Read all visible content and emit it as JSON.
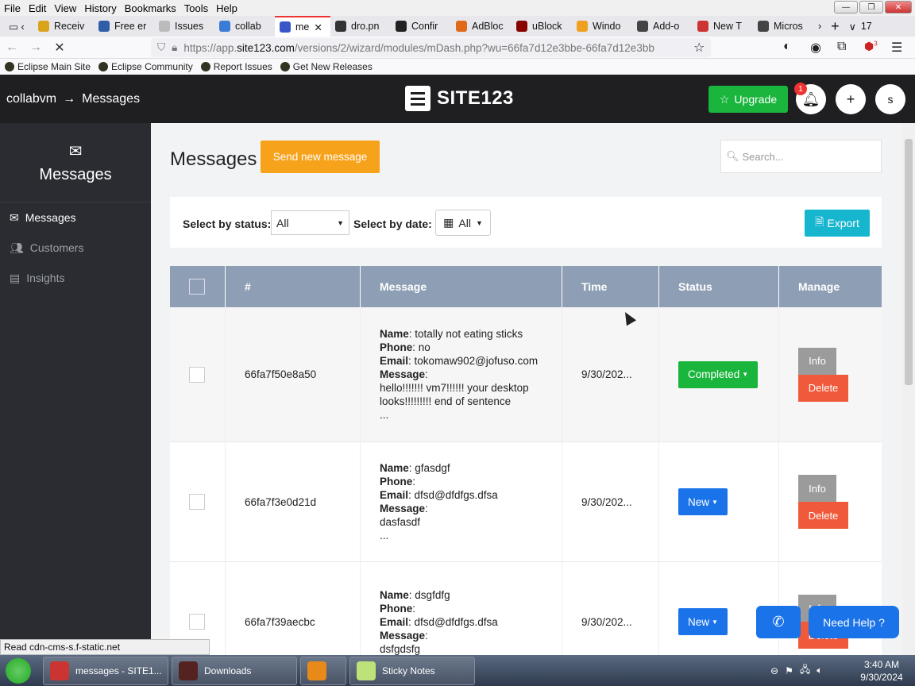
{
  "browser": {
    "menu": [
      "File",
      "Edit",
      "View",
      "History",
      "Bookmarks",
      "Tools",
      "Help"
    ],
    "tabs": [
      {
        "label": "Receiv",
        "color": "#d9a41c"
      },
      {
        "label": "Free er",
        "color": "#2f5da8"
      },
      {
        "label": "Issues",
        "color": "#bbb"
      },
      {
        "label": "collab",
        "color": "#3a7bd5"
      },
      {
        "label": "me",
        "color": "#3a55c8",
        "active": true
      },
      {
        "label": "dro.pn",
        "color": "#333"
      },
      {
        "label": "Confir",
        "color": "#222"
      },
      {
        "label": "AdBloc",
        "color": "#e06a1a"
      },
      {
        "label": "uBlock",
        "color": "#800"
      },
      {
        "label": "Windo",
        "color": "#f0a020"
      },
      {
        "label": "Add-o",
        "color": "#444"
      },
      {
        "label": "New T",
        "color": "#c33"
      },
      {
        "label": "Micros",
        "color": "#444"
      }
    ],
    "tab_count": "17",
    "url_prefix": "https://app.",
    "url_domain": "site123.com",
    "url_rest": "/versions/2/wizard/modules/mDash.php?wu=66fa7d12e3bbe-66fa7d12e3bb",
    "bookmarks": [
      "Eclipse Main Site",
      "Eclipse Community",
      "Report Issues",
      "Get New Releases"
    ],
    "addon_badge": "3"
  },
  "app": {
    "breadcrumb_site": "collabvm",
    "breadcrumb_arrow": "→",
    "breadcrumb_page": "Messages",
    "logo_text": "SITE123",
    "upgrade_label": "Upgrade",
    "notif_count": "1",
    "avatar_letter": "s"
  },
  "sidebar": {
    "title": "Messages",
    "items": [
      {
        "label": "Messages",
        "active": true
      },
      {
        "label": "Customers"
      },
      {
        "label": "Insights"
      }
    ]
  },
  "main": {
    "title": "Messages",
    "send_label": "Send new message",
    "search_placeholder": "Search...",
    "status_label": "Select by status:",
    "status_value": "All",
    "date_label": "Select by date:",
    "date_value": "All",
    "export_label": "Export"
  },
  "table": {
    "headers": [
      "#",
      "Message",
      "Time",
      "Status",
      "Manage"
    ],
    "rows": [
      {
        "id": "66fa7f50e8a50",
        "name": "totally not eating sticks",
        "phone": "no",
        "email": "tokomaw902@jofuso.com",
        "message_lines": [
          "hello!!!!!!! vm7!!!!!! your desktop",
          "looks!!!!!!!!! end of sentence",
          "..."
        ],
        "time": "9/30/202...",
        "status": "Completed",
        "status_color": "#1ab53c"
      },
      {
        "id": "66fa7f3e0d21d",
        "name": "gfasdgf",
        "phone": "",
        "email": "dfsd@dfdfgs.dfsa",
        "message_lines": [
          "dasfasdf",
          "..."
        ],
        "time": "9/30/202...",
        "status": "New",
        "status_color": "#1a73e8"
      },
      {
        "id": "66fa7f39aecbc",
        "name": "dsgfdfg",
        "phone": "",
        "email": "dfsd@dfdfgs.dfsa",
        "message_lines": [
          "dsfgdsfg"
        ],
        "time": "9/30/202...",
        "status": "New",
        "status_color": "#1a73e8"
      }
    ],
    "labels": {
      "name": "Name",
      "phone": "Phone",
      "email": "Email",
      "message": "Message",
      "info": "Info",
      "delete": "Delete"
    }
  },
  "floating": {
    "help_label": "Need Help ?"
  },
  "statusbar": "Read cdn-cms-s.f-static.net",
  "taskbar": {
    "items": [
      {
        "label": "messages - SITE1...",
        "color": "#c33"
      },
      {
        "label": "Downloads",
        "color": "#522"
      },
      {
        "label": "",
        "color": "#e88a1a"
      },
      {
        "label": "Sticky Notes",
        "color": "#bde27a"
      }
    ],
    "time": "3:40 AM",
    "date": "9/30/2024"
  }
}
